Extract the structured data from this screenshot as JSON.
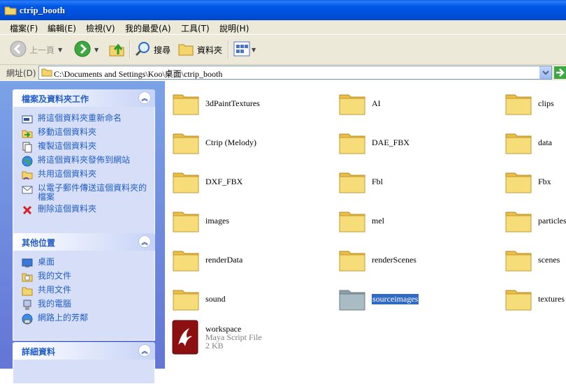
{
  "window": {
    "title": "ctrip_booth"
  },
  "menu": [
    "檔案(F)",
    "編輯(E)",
    "檢視(V)",
    "我的最愛(A)",
    "工具(T)",
    "說明(H)"
  ],
  "toolbar": {
    "back": "上一頁",
    "search": "搜尋",
    "folders": "資料夾"
  },
  "address": {
    "label": "網址(D)",
    "path": "C:\\Documents and Settings\\Koo\\桌面\\ctrip_booth"
  },
  "tasks": {
    "file_tasks": {
      "title": "檔案及資料夾工作",
      "items": [
        "將這個資料夾重新命名",
        "移動這個資料夾",
        "複製這個資料夾",
        "將這個資料夾發佈到網站",
        "共用這個資料夾",
        "以電子郵件傳送這個資料夾的檔案",
        "刪除這個資料夾"
      ]
    },
    "other_places": {
      "title": "其他位置",
      "items": [
        "桌面",
        "我的文件",
        "共用文件",
        "我的電腦",
        "網路上的芳鄰"
      ]
    },
    "details": {
      "title": "詳細資料"
    }
  },
  "files": [
    {
      "name": "3dPaintTextures"
    },
    {
      "name": "AI"
    },
    {
      "name": "clips"
    },
    {
      "name": "Ctrip (Melody)"
    },
    {
      "name": "DAE_FBX"
    },
    {
      "name": "data"
    },
    {
      "name": "DXF_FBX"
    },
    {
      "name": "Fbl"
    },
    {
      "name": "Fbx"
    },
    {
      "name": "images"
    },
    {
      "name": "mel"
    },
    {
      "name": "particles"
    },
    {
      "name": "renderData"
    },
    {
      "name": "renderScenes"
    },
    {
      "name": "scenes"
    },
    {
      "name": "sound"
    },
    {
      "name": "sourceimages",
      "selected": true
    },
    {
      "name": "textures"
    }
  ],
  "script_file": {
    "name": "workspace",
    "type": "Maya Script File",
    "size": "2 KB"
  },
  "colors": {
    "titlebar": "#0054e3",
    "panel_link": "#215dc6",
    "selection": "#316ac5",
    "folder": "#f4d46c"
  }
}
